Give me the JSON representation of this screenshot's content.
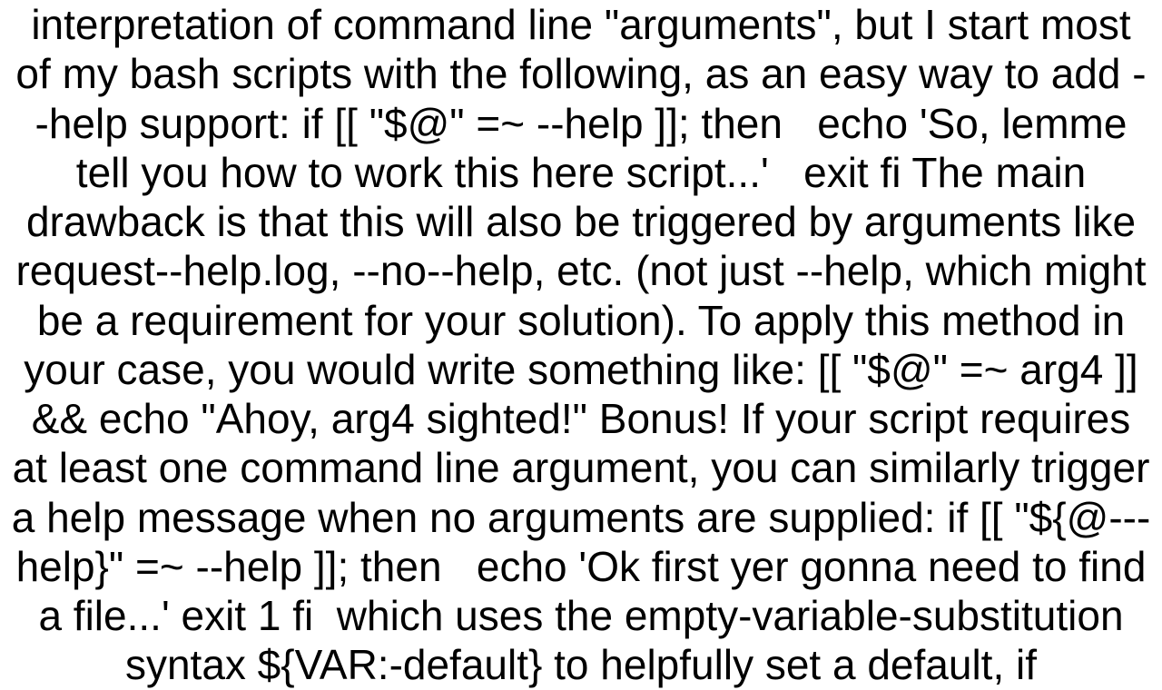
{
  "content": {
    "paragraphs": [
      "interpretation of command line \"arguments\", but I start most of my bash scripts with the following, as an easy way to add --help support: if [[ \"$@\" =~ --help ]]; then   echo 'So, lemme tell you how to work this here script...'   exit fi The main drawback is that this will also be triggered by arguments like request--help.log, --no--help, etc. (not just --help, which might be a requirement for your solution). To apply this method in your case, you would write something like: [[ \"$@\" =~ arg4 ]] && echo \"Ahoy, arg4 sighted!\" Bonus! If your script requires at least one command line argument, you can similarly trigger a help message when no arguments are supplied: if [[ \"${@---help}\" =~ --help ]]; then   echo 'Ok first yer gonna need to find a file...'   exit 1 fi  which uses the empty-variable-substitution syntax ${VAR:-default} to helpfully set a default, if"
    ]
  }
}
